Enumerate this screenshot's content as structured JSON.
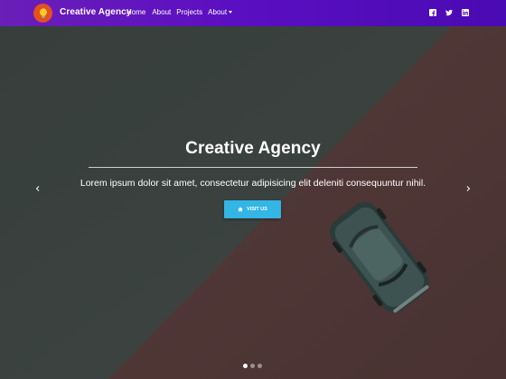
{
  "navbar": {
    "brand": "Creative Agency",
    "logo_icon": "lightbulb-icon",
    "links": [
      {
        "label": "Home"
      },
      {
        "label": "About"
      },
      {
        "label": "Projects"
      },
      {
        "label": "About",
        "dropdown": true
      }
    ],
    "social": [
      {
        "icon": "facebook-icon"
      },
      {
        "icon": "twitter-icon"
      },
      {
        "icon": "linkedin-icon"
      }
    ]
  },
  "hero": {
    "title": "Creative Agency",
    "text": "Lorem ipsum dolor sit amet, consectetur adipisicing elit deleniti consequuntur nihil.",
    "button": {
      "label": "VISIT US",
      "icon": "home-icon"
    },
    "prev_icon": "chevron-left-icon",
    "next_icon": "chevron-right-icon",
    "slides": 3,
    "active_slide": 1
  },
  "colors": {
    "navbar_start": "#6a1fb8",
    "navbar_end": "#4a0ab3",
    "logo_bg": "#e2511f",
    "button_bg": "#33b5e5",
    "bg_left": "#3b4341",
    "bg_right": "#553b3a"
  }
}
